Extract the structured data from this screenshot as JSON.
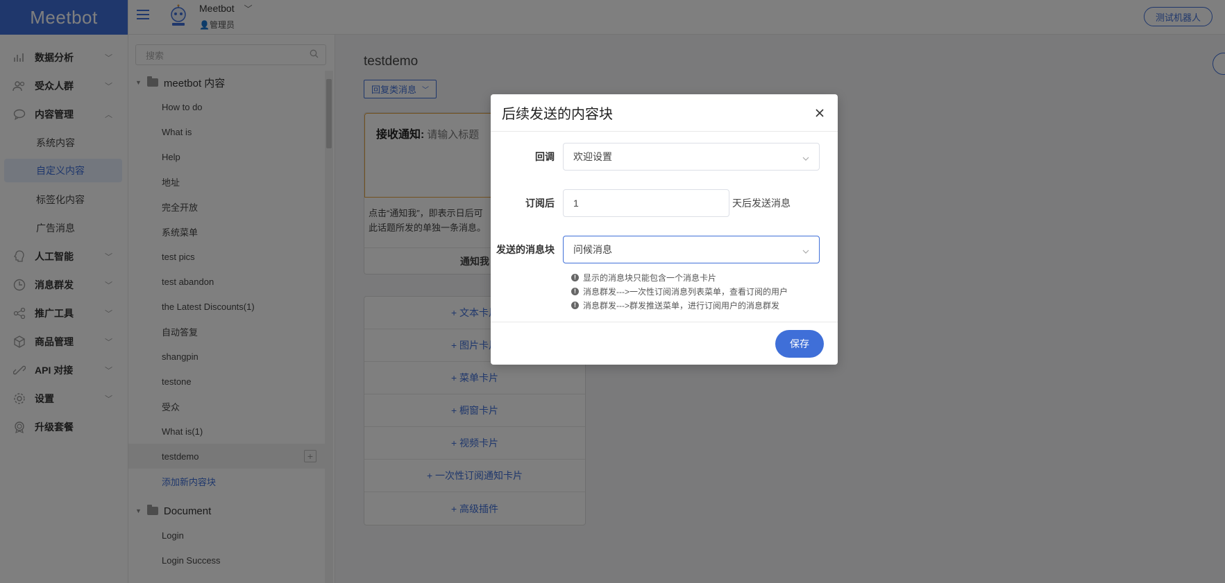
{
  "app": {
    "logo": "Meetbot"
  },
  "header": {
    "bot_name": "Meetbot",
    "bot_role": "管理员",
    "test_button": "测试机器人"
  },
  "nav": {
    "items": [
      {
        "label": "数据分析",
        "icon": "chart-icon"
      },
      {
        "label": "受众人群",
        "icon": "users-icon"
      },
      {
        "label": "内容管理",
        "icon": "chat-icon",
        "expanded": true,
        "subitems": [
          "系统内容",
          "自定义内容",
          "标签化内容",
          "广告消息"
        ],
        "active": "自定义内容"
      },
      {
        "label": "人工智能",
        "icon": "ai-icon"
      },
      {
        "label": "消息群发",
        "icon": "clock-icon"
      },
      {
        "label": "推广工具",
        "icon": "share-icon"
      },
      {
        "label": "商品管理",
        "icon": "box-icon"
      },
      {
        "label": "API 对接",
        "icon": "api-icon"
      },
      {
        "label": "设置",
        "icon": "gear-icon"
      },
      {
        "label": "升级套餐",
        "icon": "medal-icon"
      }
    ]
  },
  "tree": {
    "search_placeholder": "搜索",
    "folders": [
      {
        "name": "meetbot 内容",
        "items": [
          "How to do",
          "What is",
          "Help",
          "地址",
          "完全开放",
          "系统菜单",
          "test pics",
          "test abandon",
          "the Latest Discounts(1)",
          "自动答复",
          "shangpin",
          "testone",
          "受众",
          "What is(1)",
          "testdemo"
        ],
        "selected": "testdemo",
        "add_label": "添加新内容块"
      },
      {
        "name": "Document",
        "items": [
          "Login",
          "Login Success"
        ]
      }
    ]
  },
  "main": {
    "title": "testdemo",
    "reply_button": "回复类消息",
    "card": {
      "heading": "接收通知:",
      "placeholder": "请输入标题",
      "desc_line1": "点击“通知我”，即表示日后可",
      "desc_line2": "此话题所发的单独一条消息。",
      "button": "通知我"
    },
    "adders": [
      "+ 文本卡片",
      "+ 图片卡片",
      "+ 菜单卡片",
      "+ 橱窗卡片",
      "+ 视频卡片",
      "+ 一次性订阅通知卡片",
      "+ 高级插件"
    ]
  },
  "modal": {
    "title": "后续发送的内容块",
    "callback_label": "回调",
    "callback_value": "欢迎设置",
    "subscribe_label": "订阅后",
    "subscribe_value": "1",
    "subscribe_suffix": "天后发送消息",
    "block_label": "发送的消息块",
    "block_value": "问候消息",
    "tips": [
      "显示的消息块只能包含一个消息卡片",
      "消息群发--->一次性订阅消息列表菜单，查看订阅的用户",
      "消息群发--->群发推送菜单，进行订阅用户的消息群发"
    ],
    "save_button": "保存"
  }
}
